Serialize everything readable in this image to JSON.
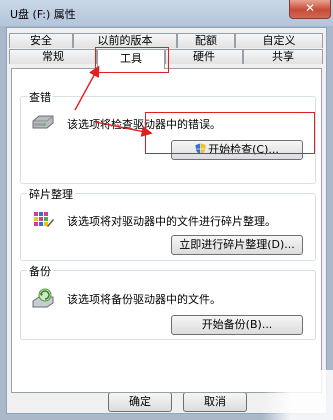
{
  "window": {
    "title": "U盘 (F:) 属性",
    "close_glyph": "✕"
  },
  "tabs_top": [
    "安全",
    "以前的版本",
    "配额",
    "自定义"
  ],
  "tabs_bottom": [
    "常规",
    "工具",
    "硬件",
    "共享"
  ],
  "active_tab": "工具",
  "sections": {
    "check": {
      "title": "查错",
      "description": "该选项将检查驱动器中的错误。",
      "button": "开始检查(C)...",
      "icon": "drive-icon"
    },
    "defrag": {
      "title": "碎片整理",
      "description": "该选项将对驱动器中的文件进行碎片整理。",
      "button": "立即进行碎片整理(D)...",
      "icon": "defrag-icon"
    },
    "backup": {
      "title": "备份",
      "description": "该选项将备份驱动器中的文件。",
      "button": "开始备份(B)...",
      "icon": "backup-icon"
    }
  },
  "footer": {
    "ok": "确定",
    "cancel": "取消"
  },
  "annotation_color": "#e02020"
}
